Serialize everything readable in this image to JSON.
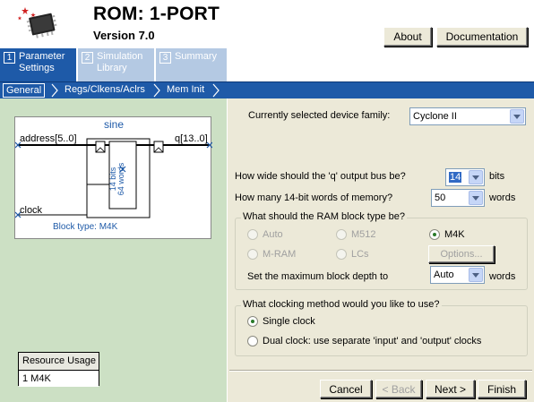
{
  "header": {
    "title": "ROM: 1-PORT",
    "version": "Version 7.0",
    "about_label": "About",
    "documentation_label": "Documentation"
  },
  "tabs": [
    {
      "num": "1",
      "label": "Parameter Settings"
    },
    {
      "num": "2",
      "label": "Simulation Library"
    },
    {
      "num": "3",
      "label": "Summary"
    }
  ],
  "subtabs": [
    "General",
    "Regs/Clkens/Aclrs",
    "Mem Init"
  ],
  "symbol": {
    "name": "sine",
    "address": "address[5..0]",
    "q": "q[13..0]",
    "clock": "clock",
    "block_text_1": "14 bits",
    "block_text_2": "64 words",
    "block_type": "Block type: M4K"
  },
  "resource": {
    "title": "Resource Usage",
    "value": "1 M4K"
  },
  "form": {
    "device_family_label": "Currently selected device family:",
    "device_family_value": "Cyclone II",
    "q_width_label": "How wide should the 'q' output bus be?",
    "q_width_value": "14",
    "q_width_unit": "bits",
    "words_label": "How many 14-bit words of memory?",
    "words_value": "50",
    "words_unit": "words",
    "ram_group_title": "What should the RAM block type be?",
    "ram_auto": "Auto",
    "ram_m512": "M512",
    "ram_m4k": "M4K",
    "ram_mram": "M-RAM",
    "ram_lcs": "LCs",
    "options_label": "Options...",
    "depth_label": "Set the maximum block depth to",
    "depth_value": "Auto",
    "depth_unit": "words",
    "clock_group_title": "What clocking method would you like to use?",
    "clock_single": "Single clock",
    "clock_dual": "Dual clock: use separate 'input' and 'output' clocks"
  },
  "footer": {
    "cancel": "Cancel",
    "back": "< Back",
    "next": "Next >",
    "finish": "Finish"
  }
}
